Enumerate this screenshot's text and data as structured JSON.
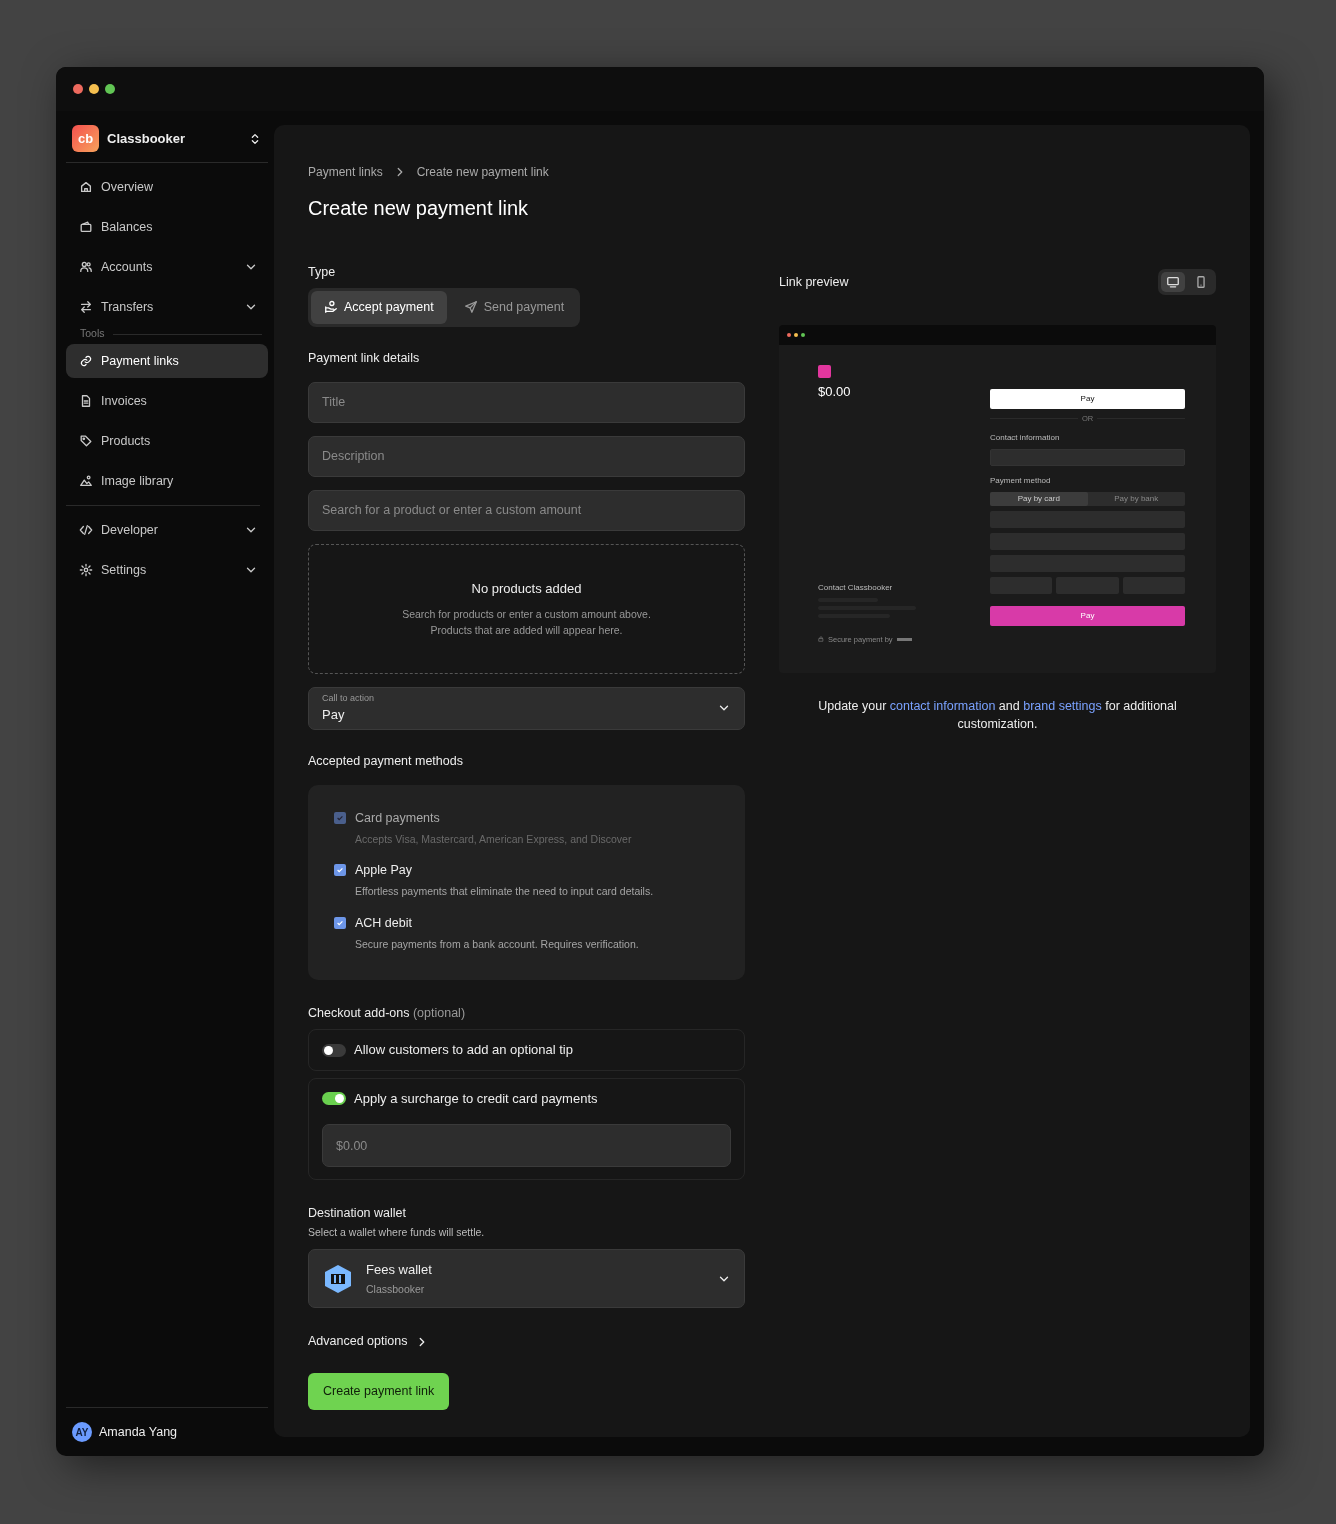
{
  "window": {
    "controls": [
      {
        "color": "#ed6a5e"
      },
      {
        "color": "#f5bf4f"
      },
      {
        "color": "#61c554"
      }
    ]
  },
  "sidebar": {
    "workspace": {
      "logo": "cb",
      "name": "Classbooker"
    },
    "groups": [
      {
        "items": [
          {
            "label": "Overview",
            "expandable": false,
            "selected": false
          },
          {
            "label": "Balances",
            "expandable": false,
            "selected": false
          },
          {
            "label": "Accounts",
            "expandable": true,
            "selected": false
          },
          {
            "label": "Transfers",
            "expandable": true,
            "selected": false
          }
        ]
      },
      {
        "heading": "Tools",
        "items": [
          {
            "label": "Payment links",
            "expandable": false,
            "selected": true
          },
          {
            "label": "Invoices",
            "expandable": false,
            "selected": false
          },
          {
            "label": "Products",
            "expandable": false,
            "selected": false
          },
          {
            "label": "Image library",
            "expandable": false,
            "selected": false
          }
        ]
      },
      {
        "items": [
          {
            "label": "Developer",
            "expandable": true,
            "selected": false
          },
          {
            "label": "Settings",
            "expandable": true,
            "selected": false
          }
        ]
      }
    ],
    "user": {
      "initials": "AY",
      "name": "Amanda Yang"
    }
  },
  "breadcrumb": [
    "Payment links",
    "Create new payment link"
  ],
  "title": "Create new payment link",
  "type": {
    "label": "Type",
    "options": [
      {
        "label": "Accept payment",
        "selected": true
      },
      {
        "label": "Send payment",
        "selected": false
      }
    ]
  },
  "details": {
    "heading": "Payment link details",
    "fields": [
      {
        "placeholder": "Title"
      },
      {
        "placeholder": "Description"
      },
      {
        "placeholder": "Search for a product or enter a custom amount"
      }
    ],
    "empty_state": {
      "title": "No products added",
      "lines": [
        "Search for products or enter a custom amount above.",
        "Products that are added will appear here."
      ]
    },
    "cta": {
      "label": "Call to action",
      "value": "Pay"
    }
  },
  "methods": {
    "heading": "Accepted payment methods",
    "items": [
      {
        "label": "Card payments",
        "description": "Accepts Visa, Mastercard, American Express, and Discover",
        "checked": true,
        "disabled": true
      },
      {
        "label": "Apple Pay",
        "description": "Effortless payments that eliminate the need to input card details.",
        "checked": true,
        "disabled": false
      },
      {
        "label": "ACH debit",
        "description": "Secure payments from a bank account. Requires verification.",
        "checked": true,
        "disabled": false
      }
    ]
  },
  "addons": {
    "heading": "Checkout add-ons",
    "note": "(optional)",
    "items": [
      {
        "label": "Allow customers to add an optional tip",
        "on": false
      },
      {
        "label": "Apply a surcharge to credit card payments",
        "on": true,
        "amount_placeholder": "$0.00"
      }
    ]
  },
  "wallet": {
    "heading": "Destination wallet",
    "subtitle": "Select a wallet where funds will settle.",
    "name": "Fees wallet",
    "org": "Classbooker"
  },
  "advanced": "Advanced options",
  "submit": "Create payment link",
  "preview": {
    "heading": "Link preview",
    "devices": [
      {
        "selected": true
      },
      {
        "selected": false
      }
    ],
    "frame": {
      "amount": "$0.00",
      "apple_pay": "Pay",
      "divider": "OR",
      "contact_heading": "Contact information",
      "method_heading": "Payment method",
      "method_tabs": [
        {
          "label": "Pay by card",
          "selected": true
        },
        {
          "label": "Pay by bank",
          "selected": false
        }
      ],
      "pay_button": "Pay",
      "merchant_contact": "Contact Classbooker",
      "secure_note": "Secure payment by"
    },
    "footnote": [
      {
        "kind": "text",
        "text": "Update your "
      },
      {
        "kind": "link",
        "text": "contact information"
      },
      {
        "kind": "text",
        "text": " and "
      },
      {
        "kind": "link",
        "text": "brand settings"
      },
      {
        "kind": "text",
        "text": " for additional customization."
      }
    ]
  }
}
